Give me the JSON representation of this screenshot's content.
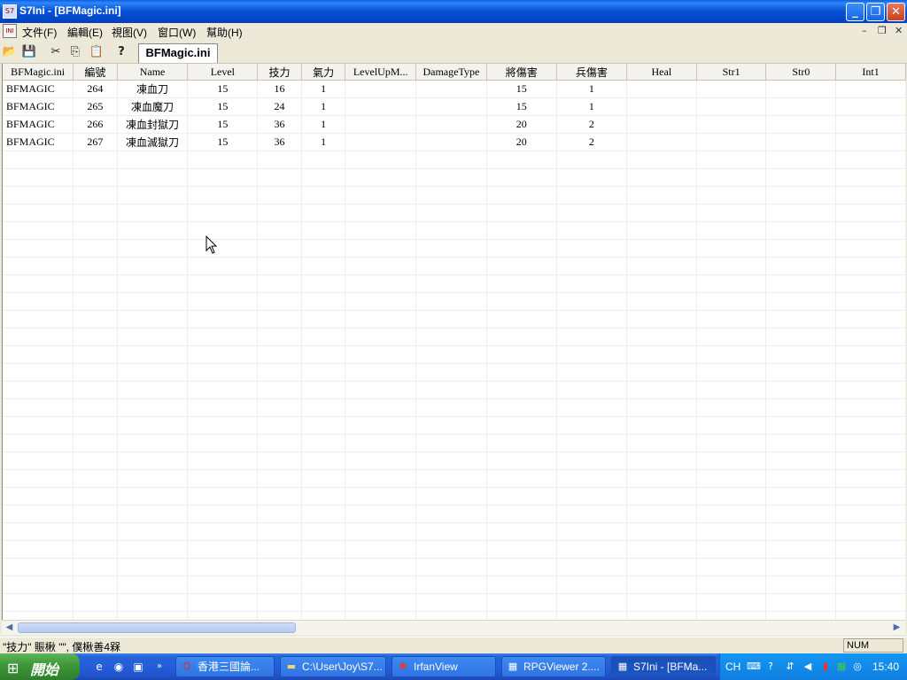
{
  "window": {
    "title": "S7Ini - [BFMagic.ini]",
    "app_icon": "s7ini-app-icon"
  },
  "menu": {
    "items": [
      "文件(F)",
      "編輯(E)",
      "視图(V)",
      "窗口(W)",
      "幫助(H)"
    ]
  },
  "toolbar": {
    "doc_tab": "BFMagic.ini"
  },
  "table": {
    "columns": [
      "BFMagic.ini",
      "編號",
      "Name",
      "Level",
      "技力",
      "氣力",
      "LevelUpM...",
      "DamageType",
      "將傷害",
      "兵傷害",
      "Heal",
      "Str1",
      "Str0",
      "Int1"
    ],
    "rows": [
      [
        "BFMAGIC",
        "264",
        "凍血刀",
        "15",
        "16",
        "1",
        "",
        "",
        "15",
        "1",
        "",
        "",
        "",
        ""
      ],
      [
        "BFMAGIC",
        "265",
        "凍血魔刀",
        "15",
        "24",
        "1",
        "",
        "",
        "15",
        "1",
        "",
        "",
        "",
        ""
      ],
      [
        "BFMAGIC",
        "266",
        "凍血封獄刀",
        "15",
        "36",
        "1",
        "",
        "",
        "20",
        "2",
        "",
        "",
        "",
        ""
      ],
      [
        "BFMAGIC",
        "267",
        "凍血滅獄刀",
        "15",
        "36",
        "1",
        "",
        "",
        "20",
        "2",
        "",
        "",
        "",
        ""
      ]
    ]
  },
  "status": {
    "message": "\"技力\" 賑楸 \"\", 僕楸善4槑",
    "num": "NUM"
  },
  "taskbar": {
    "start_label": "開始",
    "tasks": [
      "香港三國論...",
      "C:\\User\\Joy\\S7...",
      "IrfanView",
      "RPGViewer 2....",
      "S7Ini - [BFMa..."
    ],
    "lang": "CH",
    "clock": "15:40"
  }
}
